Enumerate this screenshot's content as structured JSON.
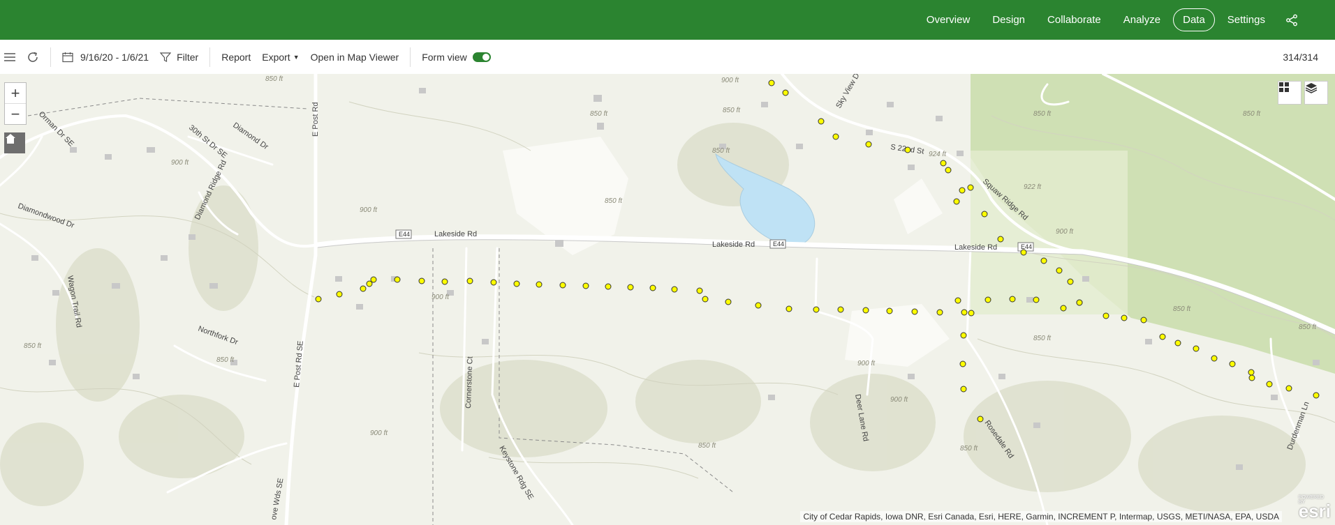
{
  "nav": {
    "items": [
      {
        "label": "Overview",
        "active": false
      },
      {
        "label": "Design",
        "active": false
      },
      {
        "label": "Collaborate",
        "active": false
      },
      {
        "label": "Analyze",
        "active": false
      },
      {
        "label": "Data",
        "active": true
      },
      {
        "label": "Settings",
        "active": false
      }
    ],
    "share_icon": "share-icon"
  },
  "toolbar": {
    "date_range": "9/16/20 - 1/6/21",
    "filter_label": "Filter",
    "report_label": "Report",
    "export_label": "Export",
    "open_map_viewer_label": "Open in Map Viewer",
    "form_view_label": "Form view",
    "form_view_on": true,
    "record_count": "314/314"
  },
  "map": {
    "zoom_in_label": "+",
    "zoom_out_label": "−",
    "roads": {
      "lakeside_1": "Lakeside Rd",
      "lakeside_2": "Lakeside Rd",
      "lakeside_3": "Lakeside Rd",
      "e44_1": "E44",
      "e44_2": "E44",
      "e44_3": "E44",
      "e_post_rd": "E Post Rd",
      "e_post_rd_se": "E Post Rd SE",
      "thirtieth_st": "30th St Dr SE",
      "diamond_dr": "Diamond Dr",
      "diamond_ridge": "Diamond Ridge Rd",
      "diamondwood": "Diamondwood Dr",
      "orman": "Orman Dr SE",
      "wagon_trail": "Wagon Trail Rd",
      "northfork": "Northfork Dr",
      "cornerstone": "Cornerstone Ct",
      "keystone": "Keystone Rdg SE",
      "deer_lane": "Deer Lane Rd",
      "rosedale": "Rosedale Rd",
      "sky_view": "Sky View D",
      "s22nd": "S 22nd St",
      "squaw_ridge": "Squaw Ridge Rd",
      "durdenman": "Durdenman Ln",
      "ove_wds": "ove Wds SE"
    },
    "elevations": {
      "e1": "850 ft",
      "e2": "900 ft",
      "e3": "850 ft",
      "e4": "850 ft",
      "e5": "850 ft",
      "e6": "924 ft",
      "e7": "922 ft",
      "e8": "900 ft",
      "e9": "850 ft",
      "e10": "850 ft",
      "e11": "900 ft",
      "e12": "900 ft",
      "e13": "850 ft",
      "e14": "900 ft",
      "e15": "850 ft",
      "e16": "900 ft",
      "e17": "850 ft",
      "e18": "850 ft",
      "e19": "850 ft",
      "e20": "900 ft",
      "e21": "850 ft",
      "e22": "900 ft",
      "e23": "850 ft",
      "e24": "850 ft"
    },
    "attribution": "City of Cedar Rapids, Iowa DNR, Esri Canada, Esri, HERE, Garmin, INCREMENT P, Intermap, USGS, METI/NASA, EPA, USDA",
    "logo_text": "esri",
    "logo_small": "POWERED BY",
    "colors": {
      "point_fill": "#ffff00",
      "point_stroke": "#333333",
      "lake": "#bfe2f5",
      "forest": "#cfe0b4"
    }
  }
}
